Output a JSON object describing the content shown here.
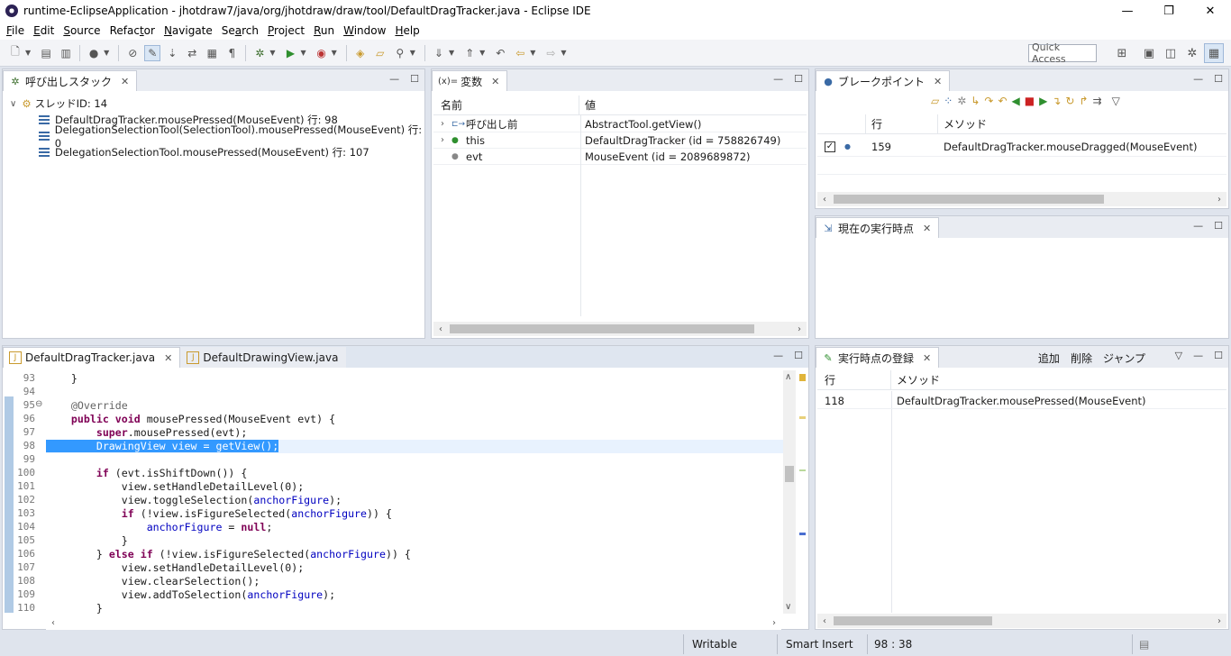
{
  "window": {
    "title": "runtime-EclipseApplication - jhotdraw7/java/org/jhotdraw/draw/tool/DefaultDragTracker.java - Eclipse IDE",
    "minimize": "—",
    "maximize": "❐",
    "close": "✕"
  },
  "menu": [
    {
      "u": "F",
      "rest": "ile"
    },
    {
      "u": "E",
      "rest": "dit"
    },
    {
      "u": "S",
      "rest": "ource"
    },
    {
      "u": "",
      "pre": "Refac",
      "u2": "t",
      "rest": "or"
    },
    {
      "u": "N",
      "rest": "avigate"
    },
    {
      "u": "",
      "pre": "Se",
      "u2": "a",
      "rest": "rch"
    },
    {
      "u": "P",
      "rest": "roject"
    },
    {
      "u": "R",
      "rest": "un"
    },
    {
      "u": "W",
      "rest": "indow"
    },
    {
      "u": "H",
      "rest": "elp"
    }
  ],
  "toolbar": {
    "quick_access": "Quick Access"
  },
  "callstack": {
    "tab": "呼び出しスタック",
    "thread": "スレッドID: 14",
    "frames": [
      "DefaultDragTracker.mousePressed(MouseEvent) 行: 98",
      "DelegationSelectionTool(SelectionTool).mousePressed(MouseEvent) 行: 0",
      "DelegationSelectionTool.mousePressed(MouseEvent) 行: 107"
    ]
  },
  "variables": {
    "tab": "変数",
    "tab_prefix": "(x)=",
    "col_name": "名前",
    "col_value": "値",
    "rows": [
      {
        "name": "呼び出し前",
        "value": "AbstractTool.getView()"
      },
      {
        "name": "this",
        "value": "DefaultDragTracker (id = 758826749)"
      },
      {
        "name": "evt",
        "value": "MouseEvent (id = 2089689872)"
      }
    ]
  },
  "breakpoints": {
    "tab": "ブレークポイント",
    "col_line": "行",
    "col_method": "メソッド",
    "rows": [
      {
        "line": "159",
        "method": "DefaultDragTracker.mouseDragged(MouseEvent)"
      }
    ]
  },
  "current_point": {
    "tab": "現在の実行時点"
  },
  "registry": {
    "tab": "実行時点の登録",
    "add": "追加",
    "delete": "削除",
    "jump": "ジャンプ",
    "col_line": "行",
    "col_method": "メソッド",
    "rows": [
      {
        "line": "118",
        "method": "DefaultDragTracker.mousePressed(MouseEvent)"
      }
    ]
  },
  "editor": {
    "tabs": [
      "DefaultDragTracker.java",
      "DefaultDrawingView.java"
    ],
    "lines": [
      {
        "n": "93",
        "html": "    }"
      },
      {
        "n": "94",
        "html": ""
      },
      {
        "n": "95",
        "fold": "⊖",
        "html": "    <span class=\"ann\">@Override</span>"
      },
      {
        "n": "96",
        "html": "    <span class=\"kw\">public</span> <span class=\"kw\">void</span> mousePressed(MouseEvent evt) {"
      },
      {
        "n": "97",
        "html": "        <span class=\"kw\">super</span>.mousePressed(evt);"
      },
      {
        "n": "98",
        "hl": true,
        "html": "        DrawingView view = getView();"
      },
      {
        "n": "99",
        "html": ""
      },
      {
        "n": "100",
        "html": "        <span class=\"kw\">if</span> (evt.isShiftDown()) {"
      },
      {
        "n": "101",
        "html": "            view.setHandleDetailLevel(0);"
      },
      {
        "n": "102",
        "html": "            view.toggleSelection(<span class=\"fld\">anchorFigure</span>);"
      },
      {
        "n": "103",
        "html": "            <span class=\"kw\">if</span> (!view.isFigureSelected(<span class=\"fld\">anchorFigure</span>)) {"
      },
      {
        "n": "104",
        "html": "                <span class=\"fld\">anchorFigure</span> = <span class=\"kw\">null</span>;"
      },
      {
        "n": "105",
        "html": "            }"
      },
      {
        "n": "106",
        "html": "        } <span class=\"kw\">else</span> <span class=\"kw\">if</span> (!view.isFigureSelected(<span class=\"fld\">anchorFigure</span>)) {"
      },
      {
        "n": "107",
        "html": "            view.setHandleDetailLevel(0);"
      },
      {
        "n": "108",
        "html": "            view.clearSelection();"
      },
      {
        "n": "109",
        "html": "            view.addToSelection(<span class=\"fld\">anchorFigure</span>);"
      },
      {
        "n": "110",
        "html": "        }"
      }
    ]
  },
  "status": {
    "writable": "Writable",
    "insert": "Smart Insert",
    "position": "98 : 38"
  },
  "colors": {
    "selection": "#3399ff",
    "current_line": "#e8f2fe",
    "keyword": "#7f0055",
    "field": "#0000c0"
  }
}
